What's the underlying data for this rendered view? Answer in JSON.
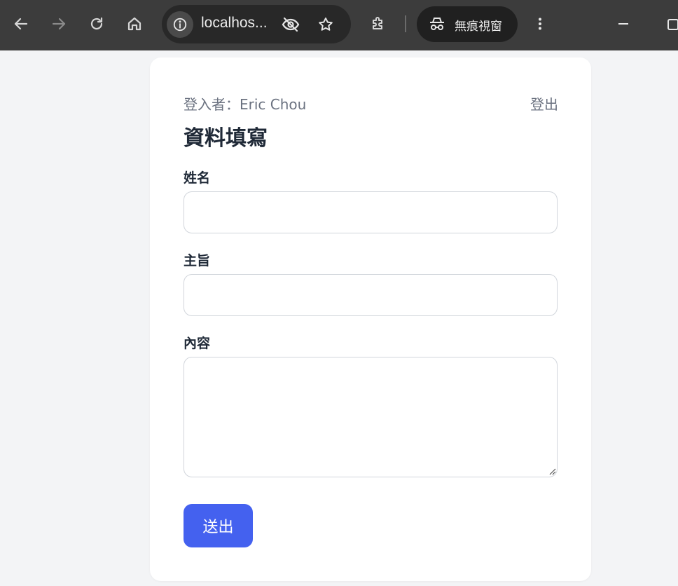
{
  "browser": {
    "url": "localhos...",
    "incognito_label": "無痕視窗"
  },
  "form": {
    "logged_in": "登入者：Eric Chou",
    "logout": "登出",
    "title": "資料填寫",
    "name_label": "姓名",
    "name_value": "",
    "subject_label": "主旨",
    "subject_value": "",
    "content_label": "內容",
    "content_value": "",
    "submit_label": "送出"
  },
  "colors": {
    "primary": "#4461ef",
    "background": "#f3f4f6",
    "toolbar": "#3c3c3c"
  }
}
